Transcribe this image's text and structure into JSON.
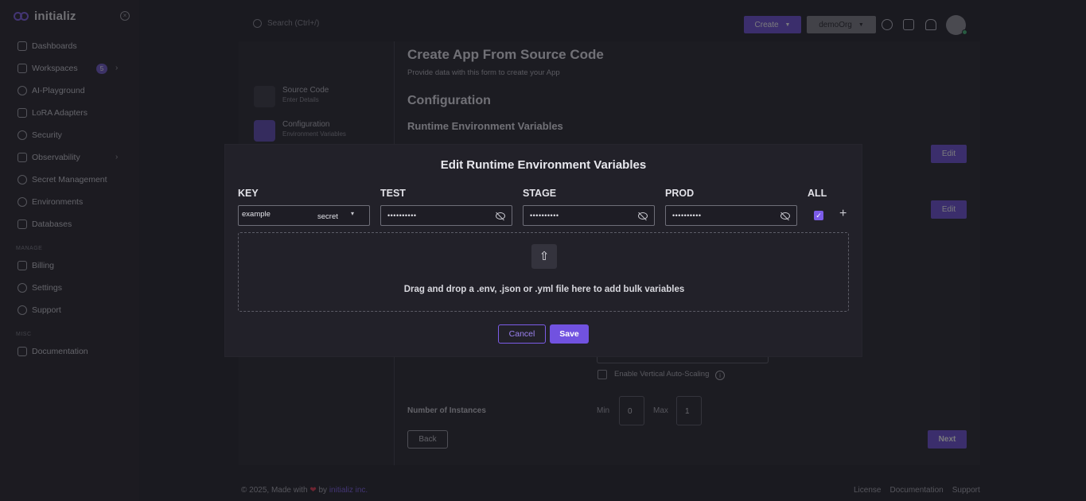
{
  "app": {
    "name": "initializ"
  },
  "sidebar": {
    "items": [
      {
        "label": "Dashboards"
      },
      {
        "label": "Workspaces",
        "badge": "5"
      },
      {
        "label": "AI-Playground"
      },
      {
        "label": "LoRA Adapters"
      },
      {
        "label": "Security"
      },
      {
        "label": "Observability"
      },
      {
        "label": "Secret Management"
      },
      {
        "label": "Environments"
      },
      {
        "label": "Databases"
      }
    ],
    "manage_heading": "MANAGE",
    "manage_items": [
      {
        "label": "Billing"
      },
      {
        "label": "Settings"
      },
      {
        "label": "Support"
      }
    ],
    "misc_heading": "MISC",
    "misc_items": [
      {
        "label": "Documentation"
      }
    ]
  },
  "topbar": {
    "search_placeholder": "Search (Ctrl+/)",
    "create_label": "Create",
    "org_label": "demoOrg"
  },
  "steps": [
    {
      "title": "Source Code",
      "subtitle": "Enter Details"
    },
    {
      "title": "Configuration",
      "subtitle": "Environment Variables"
    }
  ],
  "page": {
    "title": "Create App From Source Code",
    "subtitle": "Provide data with this form to create your App",
    "section": "Configuration",
    "subsection": "Runtime Environment Variables",
    "edit_label": "Edit",
    "vertical_scaling_label": "Enable Vertical Auto-Scaling",
    "instances_label": "Number of Instances",
    "min_label": "Min",
    "min_value": "0",
    "max_label": "Max",
    "max_value": "1",
    "back_label": "Back",
    "next_label": "Next"
  },
  "footer": {
    "copyright": "© 2025, Made with",
    "by": "by",
    "company": "initializ inc.",
    "links": [
      "License",
      "Documentation",
      "Support"
    ]
  },
  "modal": {
    "title": "Edit Runtime Environment Variables",
    "columns": {
      "key": "KEY",
      "test": "TEST",
      "stage": "STAGE",
      "prod": "PROD",
      "all": "ALL"
    },
    "row": {
      "key": "example",
      "type": "secret",
      "test": "••••••••••",
      "stage": "••••••••••",
      "prod": "••••••••••",
      "all_checked": true
    },
    "drop_text": "Drag and drop a .env, .json or .yml file here to add bulk variables",
    "cancel_label": "Cancel",
    "save_label": "Save"
  },
  "colors": {
    "accent": "#7152e0",
    "background": "#1a1a20",
    "heart": "#e0334a"
  }
}
